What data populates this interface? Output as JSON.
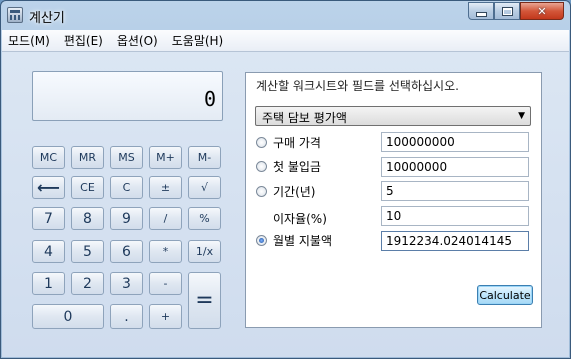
{
  "window": {
    "title": "계산기"
  },
  "menu": [
    "모드(M)",
    "편집(E)",
    "옵션(O)",
    "도움말(H)"
  ],
  "display": {
    "value": "0"
  },
  "keypad": {
    "memory": [
      "MC",
      "MR",
      "MS",
      "M+",
      "M-"
    ],
    "row2": [
      "⟵",
      "CE",
      "C",
      "±",
      "√"
    ],
    "row3": [
      "7",
      "8",
      "9",
      "/",
      "%"
    ],
    "row4": [
      "4",
      "5",
      "6",
      "*",
      "1/x"
    ],
    "row5": [
      "1",
      "2",
      "3",
      "-"
    ],
    "row6": [
      "0",
      ".",
      "+"
    ],
    "equals": "="
  },
  "worksheet": {
    "prompt": "계산할 워크시트와 필드를 선택하십시오.",
    "selected": "주택 담보 평가액",
    "fields": [
      {
        "label": "구매 가격",
        "value": "100000000",
        "radio": true,
        "checked": false
      },
      {
        "label": "첫 불입금",
        "value": "10000000",
        "radio": true,
        "checked": false
      },
      {
        "label": "기간(년)",
        "value": "5",
        "radio": true,
        "checked": false
      },
      {
        "label": "이자율(%)",
        "value": "10",
        "radio": false,
        "checked": false
      },
      {
        "label": "월별 지불액",
        "value": "1912234.024014145",
        "radio": true,
        "checked": true
      }
    ],
    "calculate_label": "Calculate"
  }
}
